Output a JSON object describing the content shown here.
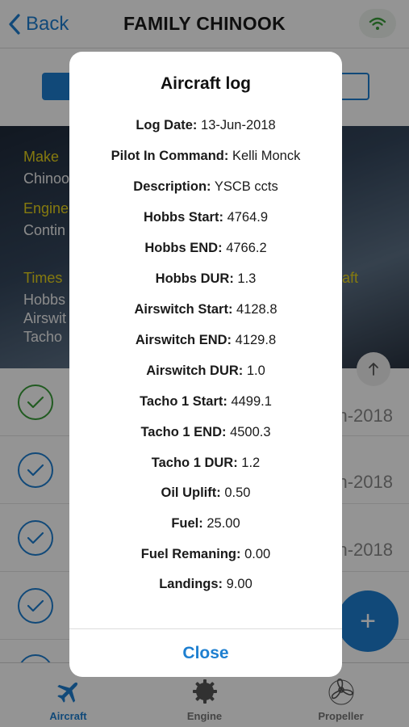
{
  "navbar": {
    "back_label": "Back",
    "title": "FAMILY CHINOOK"
  },
  "hero": {
    "make_label": "Make",
    "make_value": "Chinoo",
    "engine_label": "Engine",
    "engine_value": "Contin",
    "times_label": "Times",
    "times_right_label": "aft",
    "hobbs": "Hobbs",
    "airswitch": "Airswit",
    "tacho": "Tacho"
  },
  "list": {
    "dates": [
      "n-2018",
      "n-2018",
      "n-2018"
    ]
  },
  "fab_label": "+",
  "modal": {
    "title": "Aircraft log",
    "fields": [
      {
        "label": "Log Date:",
        "value": "13-Jun-2018"
      },
      {
        "label": "Pilot In Command:",
        "value": "Kelli Monck"
      },
      {
        "label": "Description:",
        "value": "YSCB ccts"
      },
      {
        "label": "Hobbs Start:",
        "value": "4764.9"
      },
      {
        "label": "Hobbs END:",
        "value": "4766.2"
      },
      {
        "label": "Hobbs DUR:",
        "value": "1.3"
      },
      {
        "label": "Airswitch Start:",
        "value": "4128.8"
      },
      {
        "label": "Airswitch END:",
        "value": "4129.8"
      },
      {
        "label": "Airswitch DUR:",
        "value": "1.0"
      },
      {
        "label": "Tacho 1 Start:",
        "value": "4499.1"
      },
      {
        "label": "Tacho 1 END:",
        "value": "4500.3"
      },
      {
        "label": "Tacho 1 DUR:",
        "value": "1.2"
      },
      {
        "label": "Oil Uplift:",
        "value": "0.50"
      },
      {
        "label": "Fuel:",
        "value": "25.00"
      },
      {
        "label": "Fuel Remaning:",
        "value": "0.00"
      },
      {
        "label": "Landings:",
        "value": "9.00"
      }
    ],
    "close_label": "Close"
  },
  "tabs": [
    {
      "label": "Aircraft",
      "icon": "airplane-icon",
      "active": true
    },
    {
      "label": "Engine",
      "icon": "engine-gear-icon",
      "active": false
    },
    {
      "label": "Propeller",
      "icon": "propeller-icon",
      "active": false
    }
  ],
  "colors": {
    "accent": "#1e7fd0",
    "hero_label": "#e6d21a",
    "check_green": "#3a9d3a"
  }
}
